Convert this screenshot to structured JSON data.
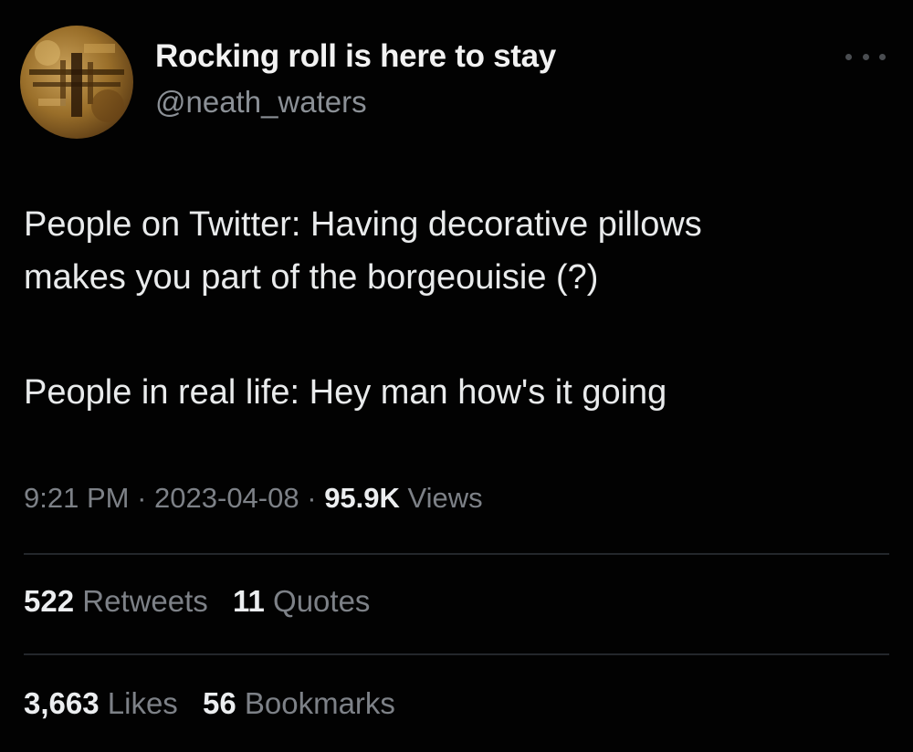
{
  "author": {
    "display_name": "Rocking roll is here to stay",
    "handle": "@neath_waters",
    "avatar": "avatar-photo"
  },
  "menu_icon": "more-horizontal-icon",
  "tweet": {
    "lines": [
      "People on Twitter: Having decorative pillows",
      "makes you part of the borgeouisie (?)",
      "People in real life: Hey man how's it going"
    ]
  },
  "meta": {
    "time": "9:21 PM",
    "separator": "·",
    "date": "2023-04-08",
    "views_count": "95.9K",
    "views_label": "Views"
  },
  "engagement": {
    "retweets_count": "522",
    "retweets_label": "Retweets",
    "quotes_count": "11",
    "quotes_label": "Quotes",
    "likes_count": "3,663",
    "likes_label": "Likes",
    "bookmarks_count": "56",
    "bookmarks_label": "Bookmarks"
  },
  "colors": {
    "background": "#000000",
    "text_primary": "#e7e9ea",
    "text_secondary": "#7d8187",
    "divider": "#23272b"
  }
}
